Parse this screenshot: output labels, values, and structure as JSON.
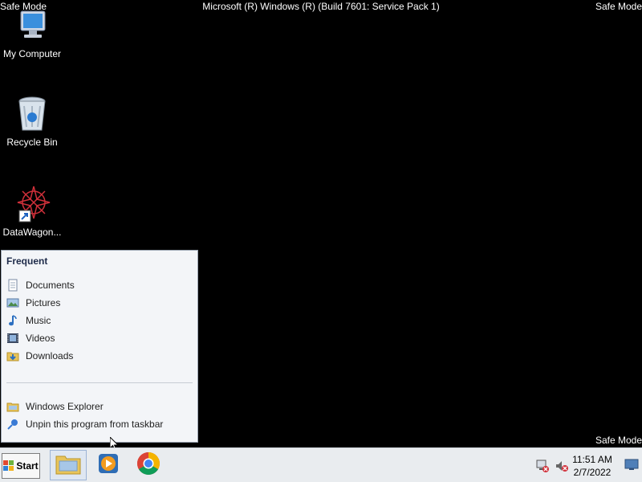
{
  "top_bar": {
    "left_label": "Safe Mode",
    "title": "Microsoft (R) Windows (R) (Build 7601: Service Pack 1)",
    "right_label": "Safe Mode",
    "bottom_right_label": "Safe Mode"
  },
  "desktop": {
    "icons": [
      {
        "label": "My Computer",
        "icon": "computer-icon"
      },
      {
        "label": "Recycle Bin",
        "icon": "recycle-bin-icon"
      },
      {
        "label": "DataWagon...",
        "icon": "app-shortcut-icon"
      }
    ]
  },
  "jumplist": {
    "heading": "Frequent",
    "items": [
      {
        "label": "Documents",
        "icon": "documents-icon"
      },
      {
        "label": "Pictures",
        "icon": "pictures-icon"
      },
      {
        "label": "Music",
        "icon": "music-icon"
      },
      {
        "label": "Videos",
        "icon": "videos-icon"
      },
      {
        "label": "Downloads",
        "icon": "downloads-icon"
      }
    ],
    "tasks": [
      {
        "label": "Windows Explorer",
        "icon": "folder-icon"
      },
      {
        "label": "Unpin this program from taskbar",
        "icon": "pin-icon"
      }
    ]
  },
  "taskbar": {
    "start_label": "Start",
    "apps": [
      {
        "icon": "windows-explorer-icon",
        "active": true
      },
      {
        "icon": "media-player-icon",
        "active": false
      },
      {
        "icon": "chrome-icon",
        "active": false
      }
    ],
    "clock": {
      "time": "11:51 AM",
      "date": "2/7/2022"
    }
  }
}
